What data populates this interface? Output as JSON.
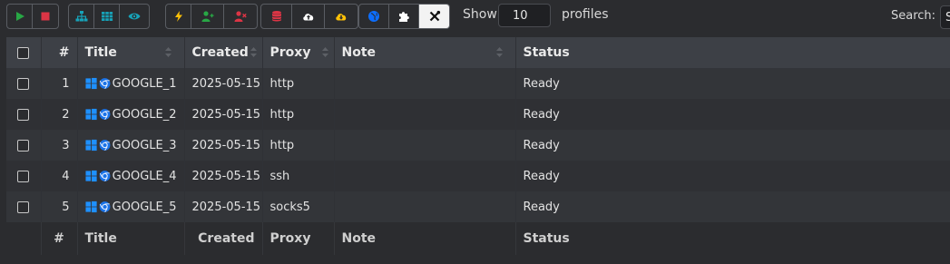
{
  "toolbar": {
    "groups": [
      [
        {
          "name": "play-icon",
          "color": "#28a745"
        },
        {
          "name": "stop-icon",
          "color": "#dc3545"
        }
      ],
      [
        {
          "name": "sitemap-icon",
          "color": "#17a2b8"
        },
        {
          "name": "grid-icon",
          "color": "#17a2b8"
        },
        {
          "name": "eye-icon",
          "color": "#17a2b8"
        }
      ],
      [
        {
          "name": "bolt-icon",
          "color": "#ffc107"
        },
        {
          "name": "user-plus-icon",
          "color": "#28a745"
        },
        {
          "name": "user-remove-icon",
          "color": "#dc3545"
        }
      ],
      [
        {
          "name": "database-icon",
          "color": "#dc3545"
        },
        {
          "name": "cloud-upload-icon",
          "color": "#ffffff"
        },
        {
          "name": "cloud-download-icon",
          "color": "#ffc107"
        }
      ],
      [
        {
          "name": "globe-icon",
          "color": "#0d6efd"
        },
        {
          "name": "puzzle-icon",
          "color": "#ffffff"
        },
        {
          "name": "tools-icon",
          "color": "#111111"
        }
      ]
    ]
  },
  "length": {
    "show_label": "Show",
    "value": "10",
    "suffix": "profiles"
  },
  "search": {
    "label": "Search:",
    "value": "S"
  },
  "table": {
    "columns": [
      "#",
      "Title",
      "Created",
      "Proxy",
      "Note",
      "Status"
    ],
    "rows": [
      {
        "num": "1",
        "title": "GOOGLE_1",
        "created": "2025-05-15",
        "proxy": "http",
        "note": "",
        "status": "Ready"
      },
      {
        "num": "2",
        "title": "GOOGLE_2",
        "created": "2025-05-15",
        "proxy": "http",
        "note": "",
        "status": "Ready"
      },
      {
        "num": "3",
        "title": "GOOGLE_3",
        "created": "2025-05-15",
        "proxy": "http",
        "note": "",
        "status": "Ready"
      },
      {
        "num": "4",
        "title": "GOOGLE_4",
        "created": "2025-05-15",
        "proxy": "ssh",
        "note": "",
        "status": "Ready"
      },
      {
        "num": "5",
        "title": "GOOGLE_5",
        "created": "2025-05-15",
        "proxy": "socks5",
        "note": "",
        "status": "Ready"
      }
    ]
  },
  "colors": {
    "windows": "#1e90ff",
    "chrome": "#1a73e8",
    "header_bg": "#3d4046"
  }
}
